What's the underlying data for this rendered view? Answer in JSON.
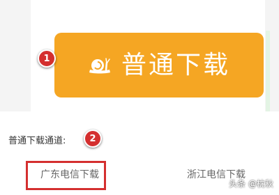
{
  "download_button": {
    "label": "普通下载",
    "icon": "snail-icon"
  },
  "markers": {
    "first": "1",
    "second": "2"
  },
  "channels": {
    "label": "普通下载通道:",
    "mirrors": [
      "广东电信下载",
      "浙江电信下载"
    ]
  },
  "watermark": "头条 @枕秋",
  "colors": {
    "button": "#f5a623",
    "annotation": "#d42f2f"
  }
}
